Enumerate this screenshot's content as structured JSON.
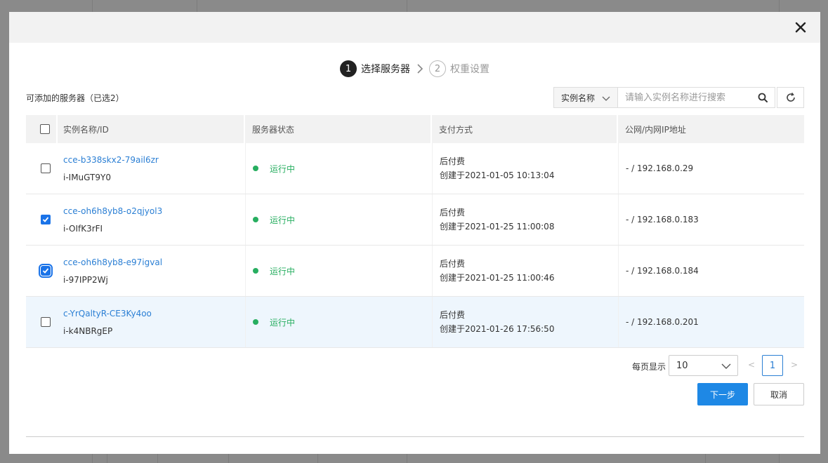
{
  "steps": [
    {
      "num": "1",
      "label": "选择服务器"
    },
    {
      "num": "2",
      "label": "权重设置"
    }
  ],
  "available_label": "可添加的服务器（已选2）",
  "search": {
    "field_label": "实例名称",
    "placeholder": "请输入实例名称进行搜索"
  },
  "table": {
    "headers": [
      "实例名称/ID",
      "服务器状态",
      "支付方式",
      "公网/内网IP地址"
    ],
    "rows": [
      {
        "name": "cce-b338skx2-79ail6zr",
        "id": "i-IMuGT9Y0",
        "status": "运行中",
        "pay": "后付费",
        "created": "创建于2021-01-05 10:13:04",
        "ip": "- / 192.168.0.29",
        "checked": false
      },
      {
        "name": "cce-oh6h8yb8-o2qjyol3",
        "id": "i-OIfK3rFI",
        "status": "运行中",
        "pay": "后付费",
        "created": "创建于2021-01-25 11:00:08",
        "ip": "- / 192.168.0.183",
        "checked": true
      },
      {
        "name": "cce-oh6h8yb8-e97igval",
        "id": "i-97IPP2Wj",
        "status": "运行中",
        "pay": "后付费",
        "created": "创建于2021-01-25 11:00:46",
        "ip": "- / 192.168.0.184",
        "checked": true
      },
      {
        "name": "c-YrQaltyR-CE3Ky4oo",
        "id": "i-k4NBRgEP",
        "status": "运行中",
        "pay": "后付费",
        "created": "创建于2021-01-26 17:56:50",
        "ip": "- / 192.168.0.201",
        "checked": false
      }
    ]
  },
  "pager": {
    "per_page_label": "每页显示",
    "per_page": "10",
    "prev": "<",
    "page": "1",
    "next": ">"
  },
  "buttons": {
    "next": "下一步",
    "cancel": "取消"
  },
  "colors": {
    "primary": "#1e88e5",
    "link": "#2b7fd4",
    "running": "#27ae60"
  }
}
